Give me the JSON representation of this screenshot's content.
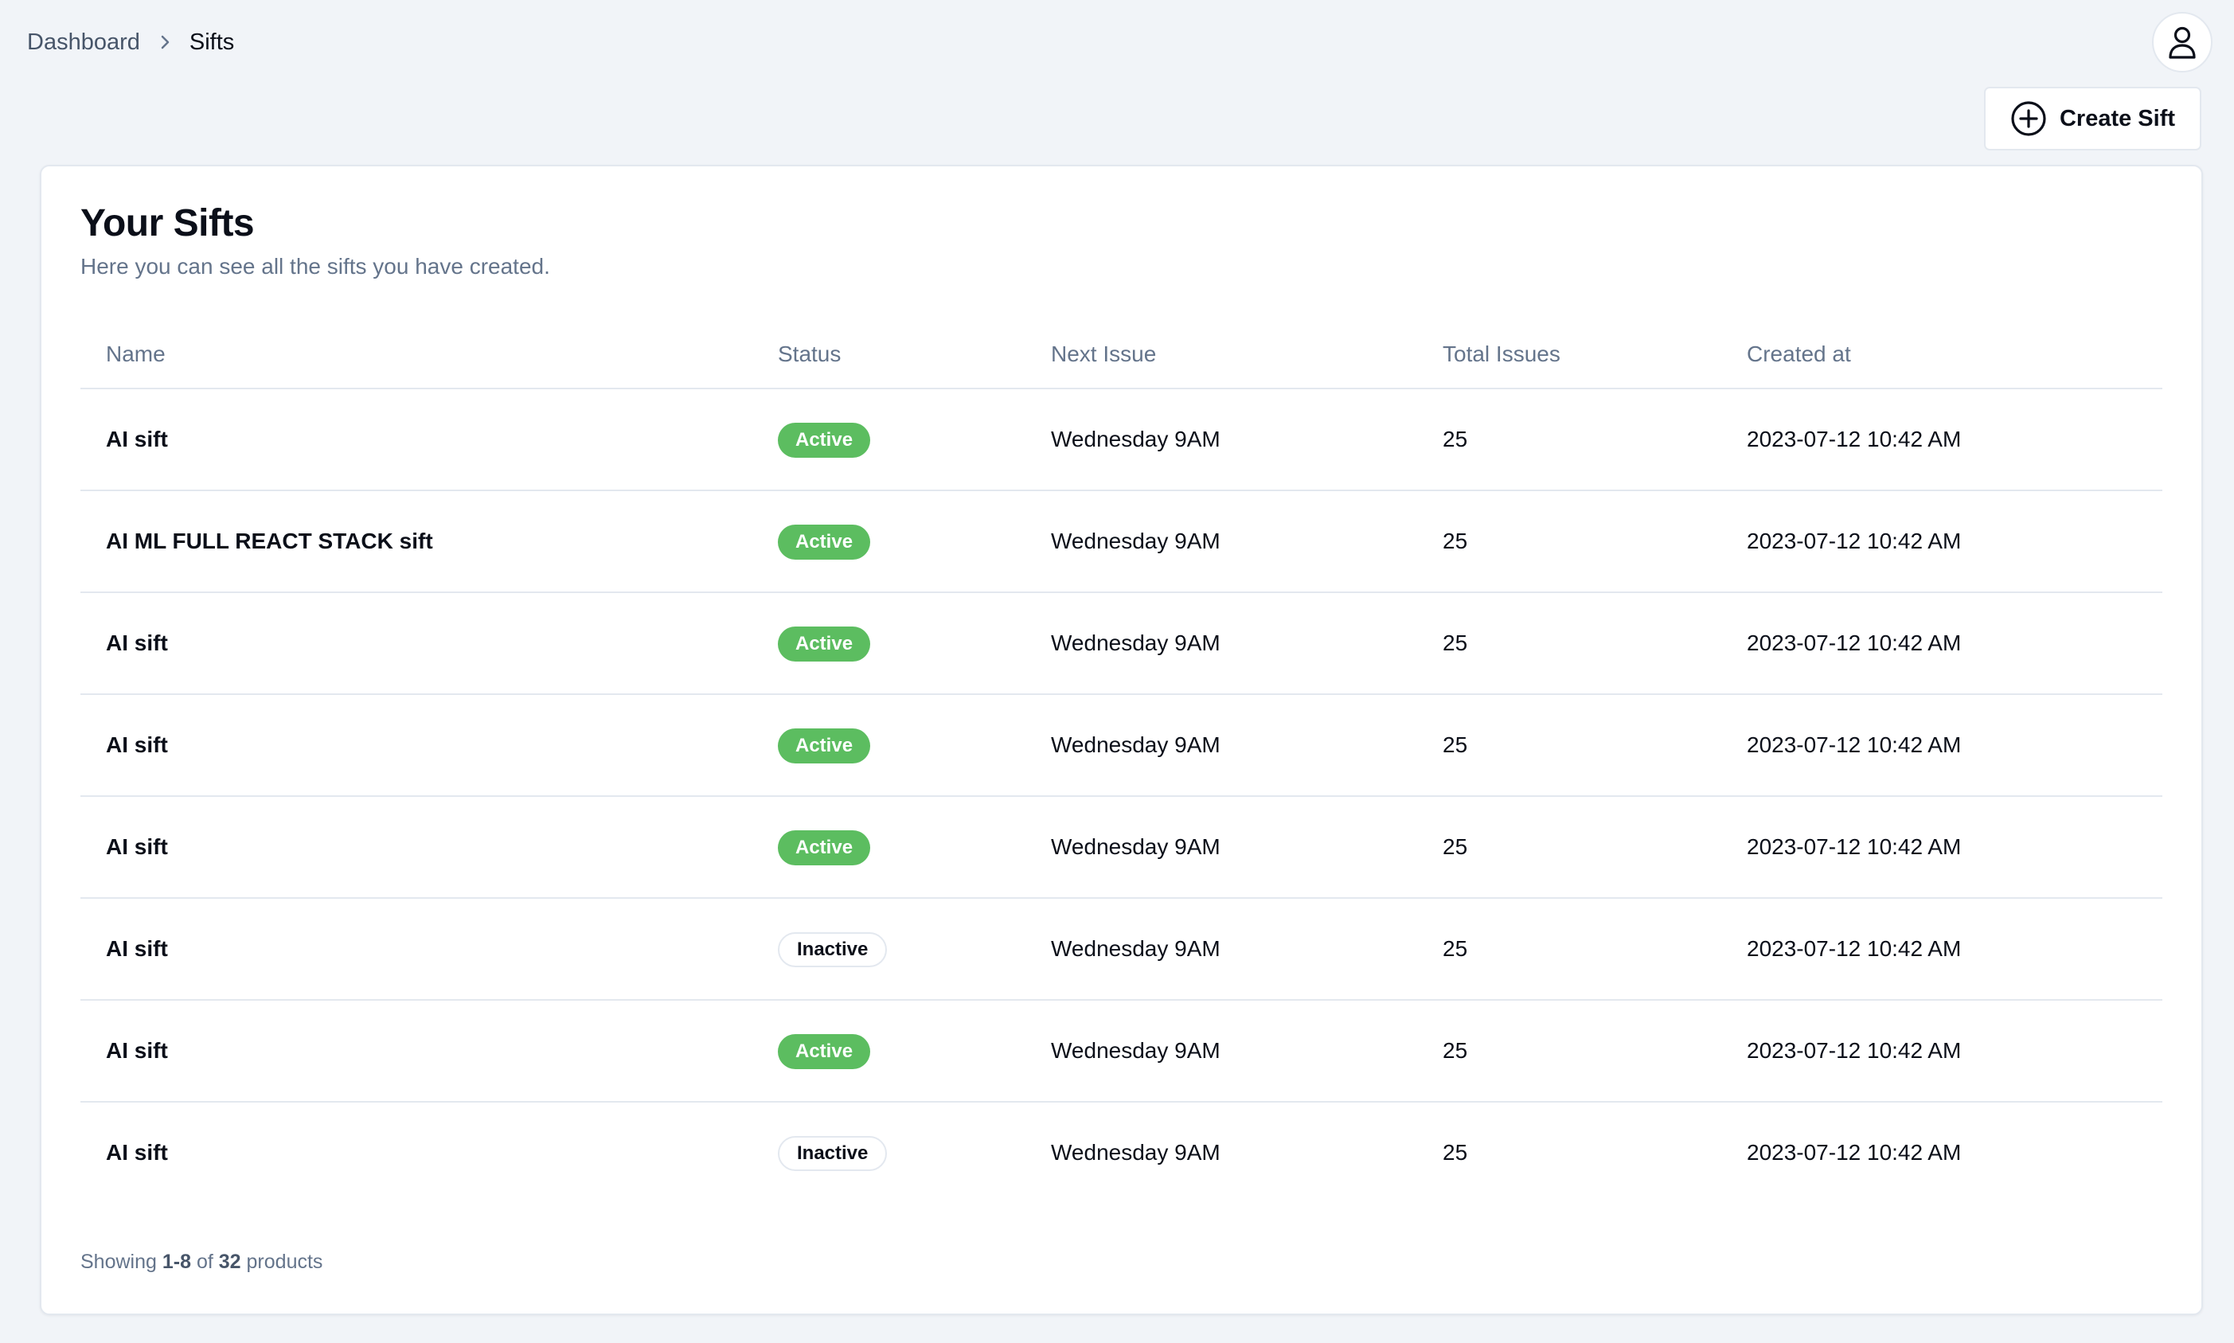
{
  "breadcrumb": {
    "items": [
      "Dashboard",
      "Sifts"
    ]
  },
  "header": {
    "create_button_label": "Create Sift"
  },
  "card": {
    "title": "Your Sifts",
    "subtitle": "Here you can see all the sifts you have created."
  },
  "table": {
    "columns": [
      "Name",
      "Status",
      "Next Issue",
      "Total Issues",
      "Created at"
    ],
    "rows": [
      {
        "name": "AI sift",
        "status": "Active",
        "next_issue": "Wednesday 9AM",
        "total_issues": "25",
        "created_at": "2023-07-12 10:42 AM"
      },
      {
        "name": "AI ML FULL REACT STACK sift",
        "status": "Active",
        "next_issue": "Wednesday 9AM",
        "total_issues": "25",
        "created_at": "2023-07-12 10:42 AM"
      },
      {
        "name": "AI sift",
        "status": "Active",
        "next_issue": "Wednesday 9AM",
        "total_issues": "25",
        "created_at": "2023-07-12 10:42 AM"
      },
      {
        "name": "AI sift",
        "status": "Active",
        "next_issue": "Wednesday 9AM",
        "total_issues": "25",
        "created_at": "2023-07-12 10:42 AM"
      },
      {
        "name": "AI sift",
        "status": "Active",
        "next_issue": "Wednesday 9AM",
        "total_issues": "25",
        "created_at": "2023-07-12 10:42 AM"
      },
      {
        "name": "AI sift",
        "status": "Inactive",
        "next_issue": "Wednesday 9AM",
        "total_issues": "25",
        "created_at": "2023-07-12 10:42 AM"
      },
      {
        "name": "AI sift",
        "status": "Active",
        "next_issue": "Wednesday 9AM",
        "total_issues": "25",
        "created_at": "2023-07-12 10:42 AM"
      },
      {
        "name": "AI sift",
        "status": "Inactive",
        "next_issue": "Wednesday 9AM",
        "total_issues": "25",
        "created_at": "2023-07-12 10:42 AM"
      }
    ]
  },
  "pagination": {
    "prefix": "Showing",
    "range": "1-8",
    "of_label": "of",
    "total": "32",
    "suffix": "products"
  },
  "icons": {
    "breadcrumb_separator": "chevron-right-icon",
    "avatar": "user-icon",
    "create": "plus-circle-icon"
  },
  "colors": {
    "background": "#f1f4f8",
    "card": "#ffffff",
    "border": "#e3e8ef",
    "text": "#0b0f19",
    "muted": "#64748b",
    "active_badge": "#5cbd60"
  }
}
